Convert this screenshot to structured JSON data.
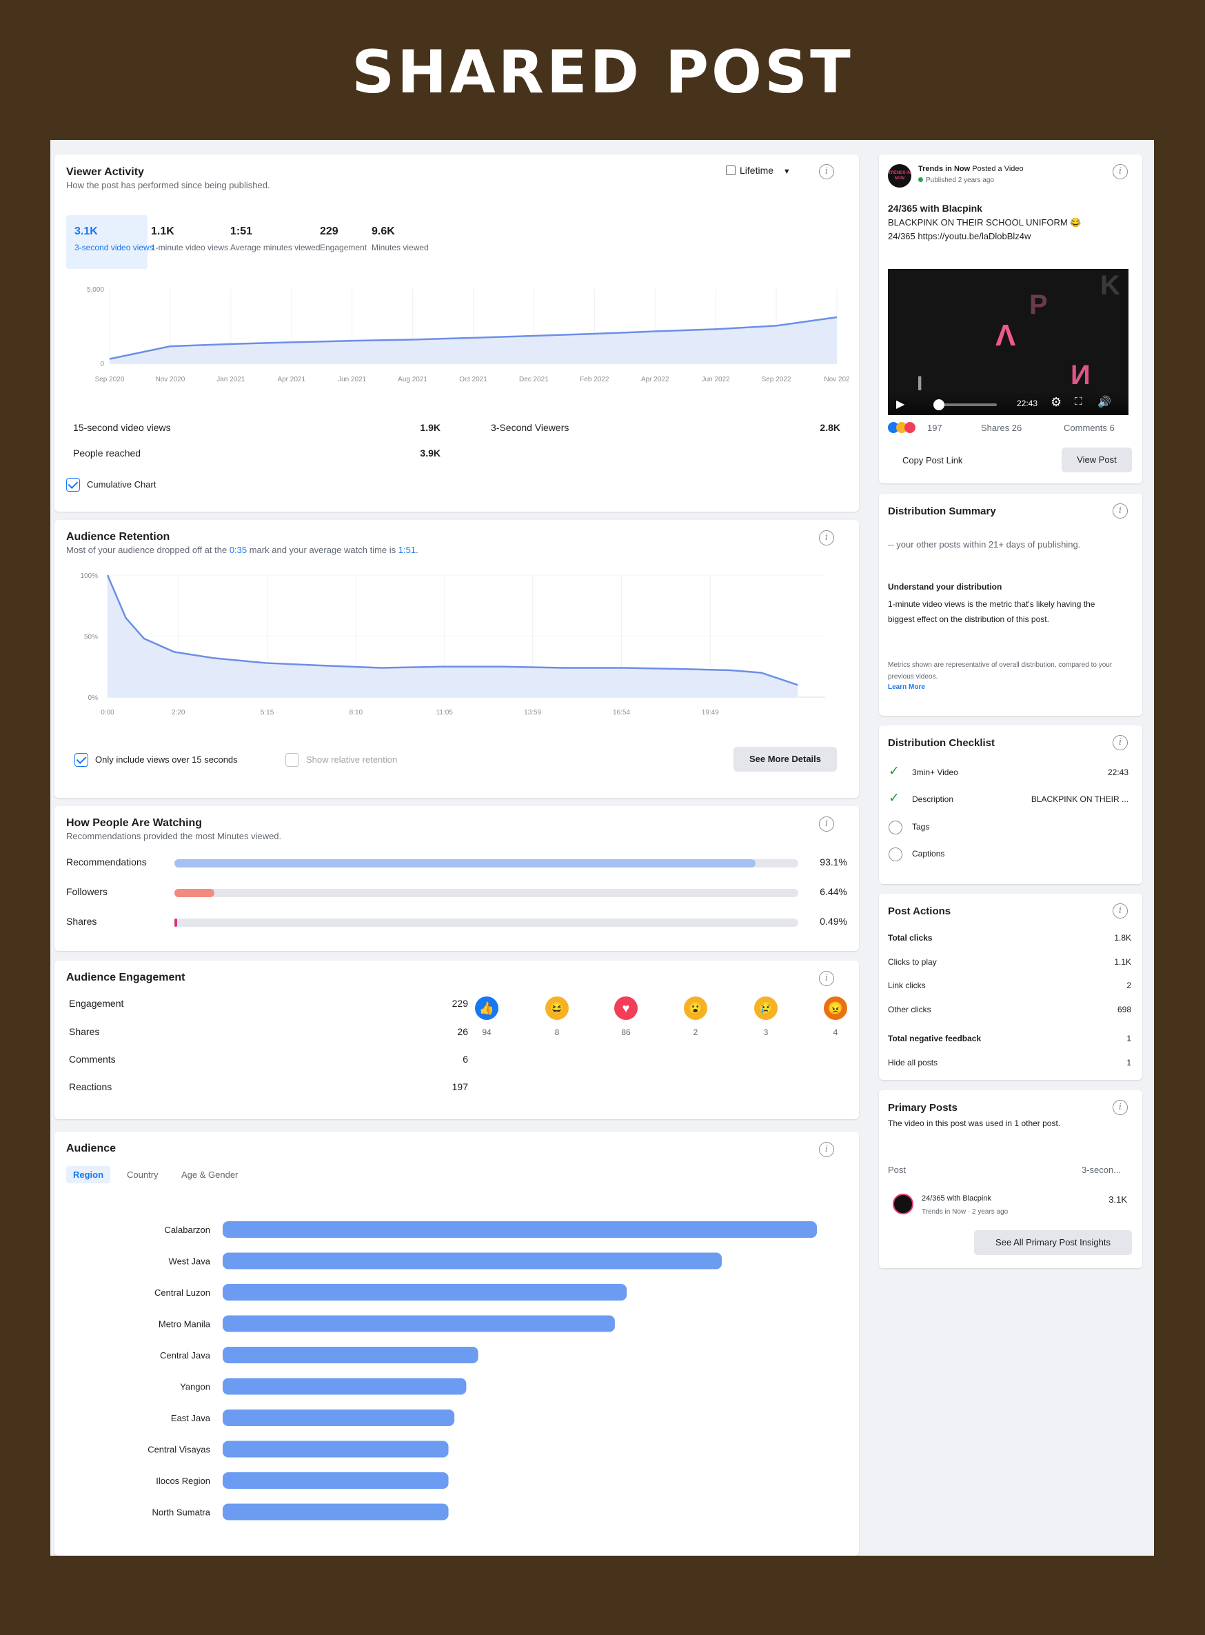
{
  "banner": {
    "title": "SHARED POST"
  },
  "viewer_activity": {
    "title": "Viewer Activity",
    "subtitle": "How the post has performed since being published.",
    "range_label": "Lifetime",
    "metrics": [
      {
        "value": "3.1K",
        "label": "3-second video views"
      },
      {
        "value": "1.1K",
        "label": "1-minute video views"
      },
      {
        "value": "1:51",
        "label": "Average minutes viewed"
      },
      {
        "value": "229",
        "label": "Engagement"
      },
      {
        "value": "9.6K",
        "label": "Minutes viewed"
      }
    ],
    "chart_data": {
      "type": "area",
      "x": [
        "Sep 2020",
        "Nov 2020",
        "Jan 2021",
        "Apr 2021",
        "Jun 2021",
        "Aug 2021",
        "Oct 2021",
        "Dec 2021",
        "Feb 2022",
        "Apr 2022",
        "Jun 2022",
        "Sep 2022",
        "Nov 202"
      ],
      "values": [
        300,
        1150,
        1300,
        1420,
        1520,
        1600,
        1720,
        1850,
        1990,
        2150,
        2300,
        2530,
        3100
      ],
      "ylim": [
        0,
        5000
      ],
      "yticks": [
        "5,000",
        "0"
      ],
      "color": "#6b8ee8"
    },
    "stats": [
      {
        "label": "15-second video views",
        "value": "1.9K"
      },
      {
        "label": "3-Second Viewers",
        "value": "2.8K"
      },
      {
        "label": "People reached",
        "value": "3.9K"
      }
    ],
    "checkbox_label": "Cumulative Chart"
  },
  "audience_retention": {
    "title": "Audience Retention",
    "subtitle_pre": "Most of your audience dropped off at the ",
    "subtitle_mark": "0:35",
    "subtitle_mid": " mark and your average watch time is ",
    "subtitle_avg": "1:51",
    "subtitle_post": ".",
    "chart_data": {
      "type": "area",
      "x": [
        "0:00",
        "2:20",
        "5:15",
        "8:10",
        "11:05",
        "13:59",
        "16:54",
        "19:49"
      ],
      "points_x_min": [
        0,
        0.6,
        1.2,
        2.2,
        3.5,
        5.2,
        7.0,
        9.0,
        11.0,
        13.0,
        15.0,
        17.0,
        19.0,
        20.5,
        21.5,
        22.7
      ],
      "values": [
        100,
        65,
        48,
        37,
        32,
        28,
        26,
        24,
        25,
        25,
        24,
        24,
        23,
        22,
        20,
        10
      ],
      "ylim": [
        0,
        100
      ],
      "yticks": [
        "100%",
        "50%",
        "0%"
      ],
      "color": "#6b8ee8"
    },
    "checkbox1": "Only include views over 15 seconds",
    "checkbox2": "Show relative retention",
    "button": "See More Details"
  },
  "how_watching": {
    "title": "How People Are Watching",
    "subtitle": "Recommendations provided the most Minutes viewed.",
    "chart_data": {
      "type": "bar",
      "categories": [
        "Recommendations",
        "Followers",
        "Shares"
      ],
      "values": [
        93.1,
        6.44,
        0.49
      ],
      "labels": [
        "93.1%",
        "6.44%",
        "0.49%"
      ],
      "colors": [
        "#a4c0f4",
        "#f28b7d",
        "#d63384"
      ]
    }
  },
  "audience_engagement": {
    "title": "Audience Engagement",
    "rows": [
      {
        "label": "Engagement",
        "value": "229"
      },
      {
        "label": "Shares",
        "value": "26"
      },
      {
        "label": "Comments",
        "value": "6"
      },
      {
        "label": "Reactions",
        "value": "197"
      }
    ],
    "reactions": [
      {
        "icon": "like-icon",
        "count": "94",
        "color": "#1877f2",
        "glyph": "👍"
      },
      {
        "icon": "haha-icon",
        "count": "8",
        "color": "#f7b125",
        "glyph": "😆"
      },
      {
        "icon": "love-icon",
        "count": "86",
        "color": "#f33e58",
        "glyph": "♥"
      },
      {
        "icon": "wow-icon",
        "count": "2",
        "color": "#f7b125",
        "glyph": "😮"
      },
      {
        "icon": "sad-icon",
        "count": "3",
        "color": "#f7b125",
        "glyph": "😢"
      },
      {
        "icon": "angry-icon",
        "count": "4",
        "color": "#e9710f",
        "glyph": "😠"
      }
    ]
  },
  "audience": {
    "title": "Audience",
    "tabs": [
      "Region",
      "Country",
      "Age & Gender"
    ],
    "chart_data": {
      "type": "bar",
      "orientation": "horizontal",
      "categories": [
        "Calabarzon",
        "West Java",
        "Central Luzon",
        "Metro Manila",
        "Central Java",
        "Yangon",
        "East Java",
        "Central Visayas",
        "Ilocos Region",
        "North Sumatra"
      ],
      "values": [
        100,
        84,
        68,
        66,
        43,
        41,
        39,
        38,
        38,
        38
      ],
      "color": "#6b9cf2"
    }
  },
  "post_preview": {
    "page_name": "Trends in Now",
    "action": "Posted a Video",
    "published": "Published 2 years ago",
    "avatar_text": "TRENDS IN NOW",
    "post_title": "24/365 with Blacpink",
    "post_line1": "BLACKPINK ON THEIR SCHOOL UNIFORM 😂",
    "post_line2": "24/365 https://youtu.be/laDlobBlz4w",
    "video_time": "22:43",
    "video_letters": [
      "K",
      "P",
      "Λ",
      "И",
      "I"
    ],
    "reactions_count": "197",
    "shares": "Shares 26",
    "comments": "Comments 6",
    "copy_link": "Copy Post Link",
    "view_post": "View Post"
  },
  "distribution_summary": {
    "title": "Distribution Summary",
    "text": "-- your other posts within 21+ days of publishing.",
    "heading": "Understand your distribution",
    "body": "1-minute video views is the metric that's likely having the biggest effect on the distribution of this post.",
    "note": "Metrics shown are representative of overall distribution, compared to your previous videos.",
    "link": "Learn More"
  },
  "distribution_checklist": {
    "title": "Distribution Checklist",
    "items": [
      {
        "label": "3min+ Video",
        "value": "22:43",
        "done": true
      },
      {
        "label": "Description",
        "value": "BLACKPINK ON THEIR ...",
        "done": true
      },
      {
        "label": "Tags",
        "value": "",
        "done": false
      },
      {
        "label": "Captions",
        "value": "",
        "done": false
      }
    ]
  },
  "post_actions": {
    "title": "Post Actions",
    "rows": [
      {
        "label": "Total clicks",
        "value": "1.8K",
        "bold": true
      },
      {
        "label": "Clicks to play",
        "value": "1.1K",
        "bold": false
      },
      {
        "label": "Link clicks",
        "value": "2",
        "bold": false
      },
      {
        "label": "Other clicks",
        "value": "698",
        "bold": false
      },
      {
        "label": "Total negative feedback",
        "value": "1",
        "bold": true
      },
      {
        "label": "Hide all posts",
        "value": "1",
        "bold": false
      }
    ]
  },
  "primary_posts": {
    "title": "Primary Posts",
    "subtitle": "The video in this post was used in 1 other post.",
    "col_post": "Post",
    "col_metric": "3-secon...",
    "post_title": "24/365 with Blacpink",
    "post_meta": "Trends in Now · 2 years ago",
    "post_value": "3.1K",
    "button": "See All Primary Post Insights"
  }
}
